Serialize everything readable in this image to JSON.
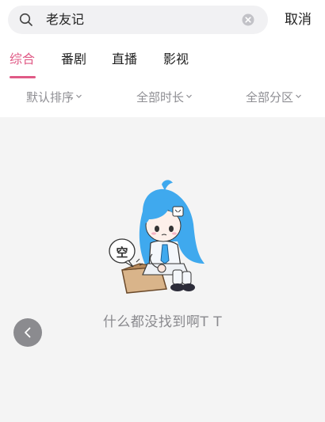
{
  "search": {
    "query": "老友记",
    "cancel_label": "取消"
  },
  "tabs": [
    {
      "label": "综合",
      "active": true
    },
    {
      "label": "番剧",
      "active": false
    },
    {
      "label": "直播",
      "active": false
    },
    {
      "label": "影视",
      "active": false
    }
  ],
  "filters": [
    {
      "label": "默认排序"
    },
    {
      "label": "全部时长"
    },
    {
      "label": "全部分区"
    }
  ],
  "empty_state": {
    "bubble_text": "空",
    "message": "什么都没找到啊T T"
  },
  "colors": {
    "accent": "#e05a86",
    "background": "#f4f4f4",
    "hair": "#3fa9ee"
  }
}
